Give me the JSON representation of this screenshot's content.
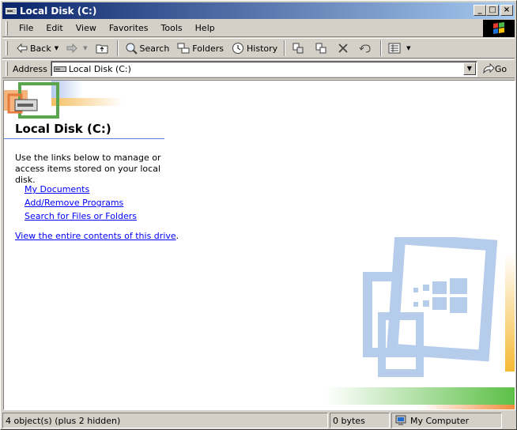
{
  "window": {
    "title": "Local Disk (C:)"
  },
  "menu": [
    "File",
    "Edit",
    "View",
    "Favorites",
    "Tools",
    "Help"
  ],
  "toolbar": {
    "back": "Back",
    "search": "Search",
    "folders": "Folders",
    "history": "History"
  },
  "address": {
    "label": "Address",
    "value": "Local Disk (C:)",
    "go": "Go"
  },
  "content": {
    "title": "Local Disk (C:)",
    "description": "Use the links below to manage or access items stored on your local disk.",
    "links": [
      "My Documents",
      "Add/Remove Programs",
      "Search for Files or Folders"
    ],
    "view_all_link": "View the entire contents of this drive",
    "view_all_suffix": "."
  },
  "status": {
    "objects": "4 object(s) (plus 2 hidden)",
    "size": "0 bytes",
    "location": "My Computer"
  },
  "colors": {
    "title_start": "#0a246a",
    "title_end": "#a6caf0",
    "link": "#0000ff"
  }
}
